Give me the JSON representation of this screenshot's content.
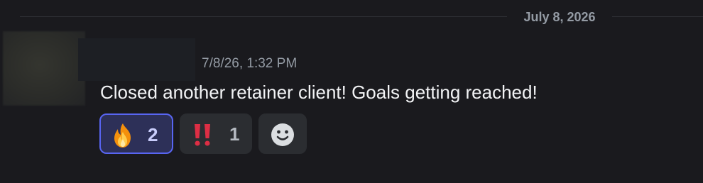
{
  "divider": {
    "date_label": "July 8, 2026"
  },
  "message": {
    "timestamp": "7/8/26, 1:32 PM",
    "content": "Closed another retainer client! Goals getting reached!",
    "reactions": [
      {
        "emoji": "fire-emoji",
        "count": "2",
        "active": true
      },
      {
        "emoji": "double-exclamation-emoji",
        "count": "1",
        "active": false
      }
    ],
    "add_reaction_icon": "smiley-face-icon"
  },
  "colors": {
    "background": "#1a1a1e",
    "accent": "#5865f2",
    "active_reaction_bg": "#2d3058",
    "reaction_bg": "#2b2d31",
    "muted_text": "#949ba4",
    "body_text": "#f2f3f5"
  }
}
